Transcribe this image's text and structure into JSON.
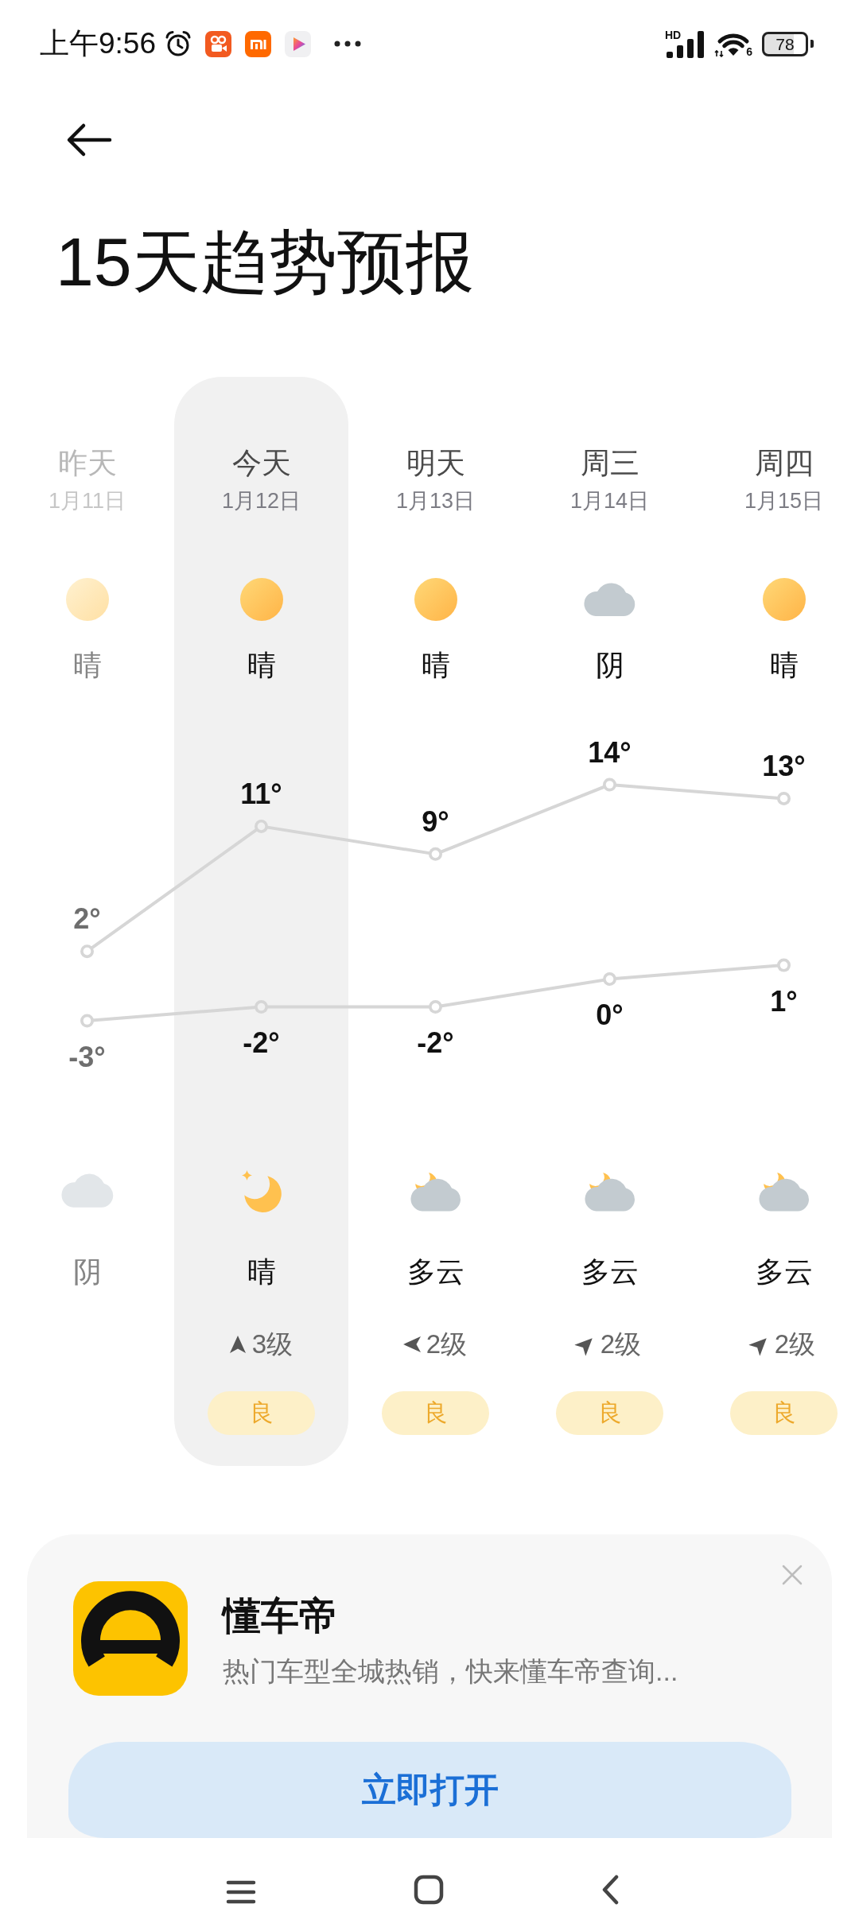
{
  "status_bar": {
    "time": "上午9:56",
    "network_type": "HD",
    "wifi_standard": "6",
    "battery": "78"
  },
  "header": {
    "title": "15天趋势预报"
  },
  "forecast": {
    "days": [
      {
        "name": "昨天",
        "date": "1月11日",
        "day": {
          "kind": "sun",
          "condition": "晴"
        },
        "night": {
          "kind": "cloud",
          "condition": "阴"
        },
        "past": true,
        "selected": false
      },
      {
        "name": "今天",
        "date": "1月12日",
        "day": {
          "kind": "sun",
          "condition": "晴"
        },
        "night": {
          "kind": "moon",
          "condition": "晴"
        },
        "wind": {
          "kind": "up",
          "level": "3级"
        },
        "aqi": "良",
        "past": false,
        "selected": true
      },
      {
        "name": "明天",
        "date": "1月13日",
        "day": {
          "kind": "sun",
          "condition": "晴"
        },
        "night": {
          "kind": "cloud-moon",
          "condition": "多云"
        },
        "wind": {
          "kind": "left",
          "level": "2级"
        },
        "aqi": "良",
        "past": false,
        "selected": false
      },
      {
        "name": "周三",
        "date": "1月14日",
        "day": {
          "kind": "cloud",
          "condition": "阴"
        },
        "night": {
          "kind": "cloud-moon",
          "condition": "多云"
        },
        "wind": {
          "kind": "up-right",
          "level": "2级"
        },
        "aqi": "良",
        "past": false,
        "selected": false
      },
      {
        "name": "周四",
        "date": "1月15日",
        "day": {
          "kind": "sun",
          "condition": "晴"
        },
        "night": {
          "kind": "cloud-moon",
          "condition": "多云"
        },
        "wind": {
          "kind": "up-right",
          "level": "2级"
        },
        "aqi": "良",
        "past": false,
        "selected": false
      }
    ],
    "chart_data": {
      "type": "line",
      "series": [
        {
          "color": "#d6d6d6",
          "marker": "circle",
          "values": [
            2,
            11,
            9,
            14,
            13
          ],
          "value_labels": [
            "2°",
            "11°",
            "9°",
            "14°",
            "13°"
          ]
        },
        {
          "color": "#d6d6d6",
          "marker": "circle",
          "values": [
            -3,
            -2,
            -2,
            0,
            1
          ],
          "value_labels": [
            "-3°",
            "-2°",
            "-2°",
            "0°",
            "1°"
          ]
        }
      ]
    }
  },
  "ad": {
    "app_name": "懂车帝",
    "description": "热门车型全城热销，快来懂车帝查询...",
    "button": "立即打开"
  }
}
